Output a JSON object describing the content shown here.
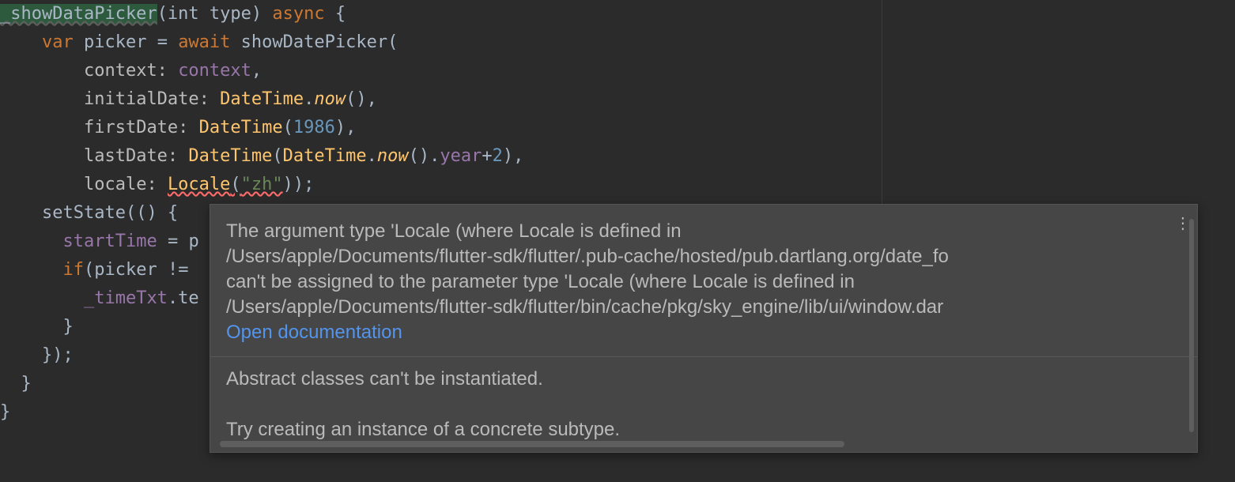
{
  "code": {
    "line1": {
      "fn": "_showDataPicker",
      "params": "(int type) ",
      "async": "async",
      "rest": " {"
    },
    "line2": {
      "indent": "    ",
      "var": "var",
      "sp1": " picker = ",
      "await": "await",
      "sp2": " ",
      "call": "showDatePicker",
      "rest": "("
    },
    "line3": {
      "indent": "        ",
      "label": "context: ",
      "val": "context",
      "rest": ","
    },
    "line4": {
      "indent": "        ",
      "label": "initialDate: ",
      "cls": "DateTime",
      "dot": ".",
      "method": "now",
      "rest": "(),"
    },
    "line5": {
      "indent": "        ",
      "label": "firstDate: ",
      "cls": "DateTime",
      "open": "(",
      "num": "1986",
      "rest": "),"
    },
    "line6": {
      "indent": "        ",
      "label": "lastDate: ",
      "cls1": "DateTime",
      "open": "(",
      "cls2": "DateTime",
      "dot": ".",
      "method": "now",
      "mid": "().",
      "prop": "year",
      "plus": "+",
      "num": "2",
      "rest": "),"
    },
    "line7": {
      "indent": "        ",
      "label": "locale: ",
      "cls": "Locale",
      "open": "(",
      "str": "\"zh\"",
      "rest": "));"
    },
    "line8": {
      "indent": "    ",
      "call": "setState",
      "rest": "(() {"
    },
    "line9": {
      "indent": "      ",
      "var": "startTime",
      "rest": " = p"
    },
    "line10": {
      "indent": "      ",
      "if": "if",
      "rest": "(picker != "
    },
    "line11": {
      "indent": "        ",
      "var": "_timeTxt",
      "rest": ".te"
    },
    "line12": {
      "indent": "      ",
      "rest": "}"
    },
    "line13": {
      "indent": "    ",
      "rest": "});"
    },
    "line14": {
      "indent": "  ",
      "rest": "}"
    },
    "line15": {
      "rest": "}"
    }
  },
  "tooltip": {
    "line1": "The argument type 'Locale (where Locale is defined in",
    "line2": "/Users/apple/Documents/flutter-sdk/flutter/.pub-cache/hosted/pub.dartlang.org/date_fo",
    "line3": " can't be assigned to the parameter type 'Locale (where Locale is defined in",
    "line4": "/Users/apple/Documents/flutter-sdk/flutter/bin/cache/pkg/sky_engine/lib/ui/window.dar",
    "link": "Open documentation",
    "abstract": "Abstract classes can't be instantiated.",
    "try": "Try creating an instance of a concrete subtype."
  }
}
